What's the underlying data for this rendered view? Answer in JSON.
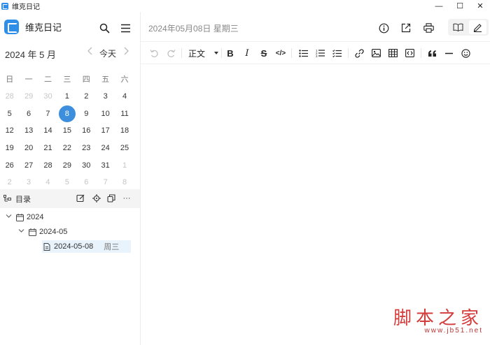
{
  "window": {
    "title": "维克日记",
    "controls": {
      "minimize": "—",
      "maximize": "☐",
      "close": "✕"
    }
  },
  "sidebar": {
    "brand_name": "维克日记",
    "calendar": {
      "month_label": "2024 年 5 月",
      "today_label": "今天",
      "weekdays": [
        "日",
        "一",
        "二",
        "三",
        "四",
        "五",
        "六"
      ],
      "weeks": [
        [
          "28",
          "29",
          "30",
          "1",
          "2",
          "3",
          "4"
        ],
        [
          "5",
          "6",
          "7",
          "8",
          "9",
          "10",
          "11"
        ],
        [
          "12",
          "13",
          "14",
          "15",
          "16",
          "17",
          "18"
        ],
        [
          "19",
          "20",
          "21",
          "22",
          "23",
          "24",
          "25"
        ],
        [
          "26",
          "27",
          "28",
          "29",
          "30",
          "31",
          "1"
        ],
        [
          "2",
          "3",
          "4",
          "5",
          "6",
          "7",
          "8"
        ]
      ],
      "selected_day": "8"
    },
    "toc": {
      "label": "目录",
      "more": "···"
    },
    "tree": {
      "year": "2024",
      "month": "2024-05",
      "entry_date": "2024-05-08",
      "entry_weekday": "周三"
    }
  },
  "main": {
    "date_header": "2024年05月08日 星期三",
    "toolbar": {
      "heading_style": "正文",
      "bold": "B",
      "italic": "I",
      "strike": "S",
      "code": "</>"
    }
  },
  "watermark": {
    "text": "脚本之家",
    "url": "www.jb51.net"
  },
  "colors": {
    "accent": "#3d8fdd",
    "brand": "#2f8fe8",
    "watermark": "#d43b3b"
  }
}
